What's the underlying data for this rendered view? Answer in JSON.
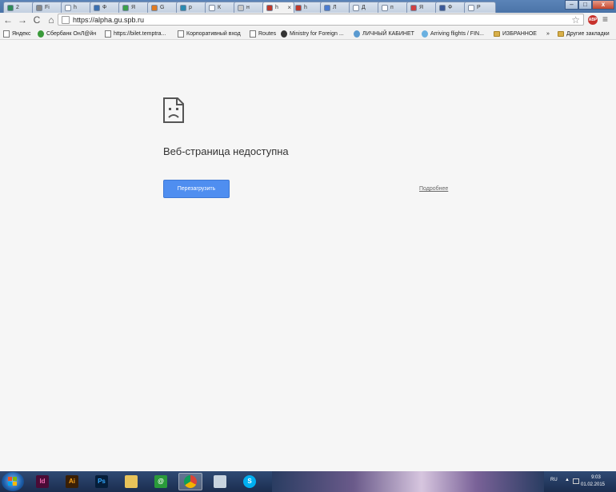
{
  "tabs": [
    {
      "label": "2",
      "color": "#2e8b57"
    },
    {
      "label": "Fi",
      "color": "#888888"
    },
    {
      "label": "h",
      "color": "#ffffff"
    },
    {
      "label": "Ф",
      "color": "#3a6fb0"
    },
    {
      "label": "Я",
      "color": "#3aa04a"
    },
    {
      "label": "G",
      "color": "#e07a20"
    },
    {
      "label": "p",
      "color": "#2a8ab0"
    },
    {
      "label": "К",
      "color": "#ffffff"
    },
    {
      "label": "н",
      "color": "#c8c8c8"
    },
    {
      "label": "h",
      "color": "#c0392b",
      "active": true
    },
    {
      "label": "h",
      "color": "#c0392b"
    },
    {
      "label": "Л",
      "color": "#4a7bd0"
    },
    {
      "label": "Д",
      "color": "#ffffff"
    },
    {
      "label": "п",
      "color": "#ffffff"
    },
    {
      "label": "Я",
      "color": "#d04040"
    },
    {
      "label": "Ф",
      "color": "#3b5998"
    },
    {
      "label": "P",
      "color": "#ffffff"
    }
  ],
  "active_tab_close": "×",
  "window_controls": {
    "minimize": "–",
    "maximize": "□",
    "close": "x"
  },
  "toolbar": {
    "back": "←",
    "forward": "→",
    "reload": "C",
    "home": "⌂",
    "url": "https://alpha.gu.spb.ru",
    "star": "☆",
    "abp": "ABP",
    "menu": "≡"
  },
  "bookmarks": [
    {
      "label": "Яндекс",
      "icon": "page-icon"
    },
    {
      "label": "Сбербанк ОнЛ@йн",
      "icon": "round-icon",
      "color": "#3a9a3a"
    },
    {
      "label": "https://bilet.temptra...",
      "icon": "page-icon"
    },
    {
      "label": "Корпоративный вход",
      "icon": "page-icon"
    },
    {
      "label": "Routes",
      "icon": "page-icon"
    },
    {
      "label": "Ministry for Foreign ...",
      "icon": "round-icon",
      "color": "#333333"
    },
    {
      "label": "ЛИЧНЫЙ КАБИНЕТ",
      "icon": "round-icon",
      "color": "#5a9ad0"
    },
    {
      "label": "Arriving flights / FIN...",
      "icon": "round-icon",
      "color": "#6ab0e0"
    },
    {
      "label": "ИЗБРАННОЕ",
      "icon": "folder-icon"
    }
  ],
  "bookmarks_overflow": "»",
  "other_bookmarks": "Другие закладки",
  "error": {
    "title": "Веб-страница недоступна",
    "reload_button": "Перезагрузить",
    "details_link": "Подробнее"
  },
  "taskbar": {
    "apps": [
      {
        "name": "indesign",
        "label": "Id",
        "bg": "#4a0b36",
        "fg": "#f06ab0"
      },
      {
        "name": "illustrator",
        "label": "Ai",
        "bg": "#3a1f05",
        "fg": "#f7a21b"
      },
      {
        "name": "photoshop",
        "label": "Ps",
        "bg": "#061e3a",
        "fg": "#31a8ff"
      },
      {
        "name": "explorer",
        "label": "",
        "bg": "#e8c35a",
        "fg": "#000000"
      },
      {
        "name": "mail-agent",
        "label": "@",
        "bg": "#2a9a3a",
        "fg": "#ffffff"
      },
      {
        "name": "chrome",
        "label": "",
        "bg": "#e0e0e0",
        "fg": "#000000",
        "active": true
      },
      {
        "name": "media",
        "label": "",
        "bg": "#c8d4e0",
        "fg": "#000000"
      },
      {
        "name": "skype",
        "label": "S",
        "bg": "#00aff0",
        "fg": "#ffffff"
      }
    ],
    "language": "RU",
    "tray_arrow": "▲",
    "time": "9:03",
    "date": "01.02.2015"
  }
}
